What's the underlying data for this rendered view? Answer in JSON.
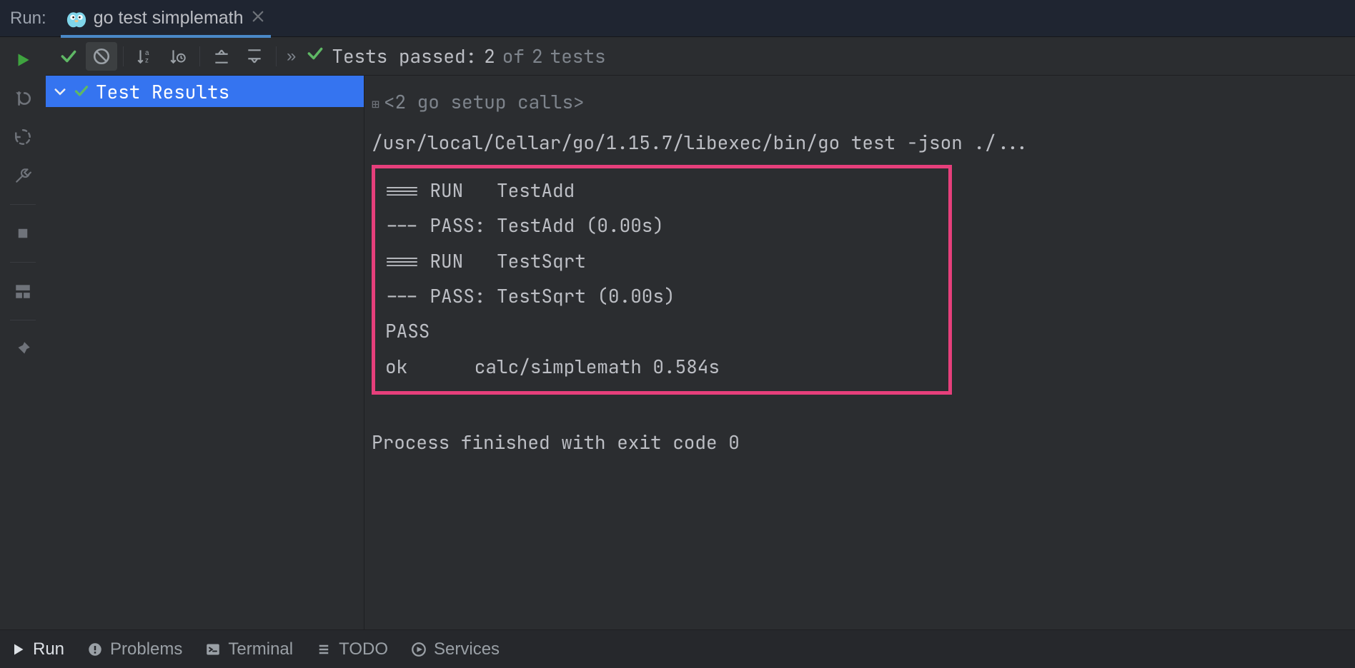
{
  "header": {
    "run_label": "Run:",
    "tab_title": "go test simplemath"
  },
  "toolbar": {
    "status_label": "Tests passed:",
    "passed": "2",
    "of_word": "of",
    "total": "2",
    "tests_word": "tests"
  },
  "tree": {
    "root_label": "Test Results"
  },
  "output": {
    "setup_fold": "<2 go setup calls>",
    "command": "/usr/local/Cellar/go/1.15.7/libexec/bin/go test -json ./...",
    "lines": [
      "=== RUN   TestAdd",
      "--- PASS: TestAdd (0.00s)",
      "=== RUN   TestSqrt",
      "--- PASS: TestSqrt (0.00s)",
      "PASS",
      "ok      calc/simplemath 0.584s"
    ],
    "exit_line": "Process finished with exit code 0"
  },
  "bottom": {
    "run": "Run",
    "problems": "Problems",
    "terminal": "Terminal",
    "todo": "TODO",
    "services": "Services"
  }
}
